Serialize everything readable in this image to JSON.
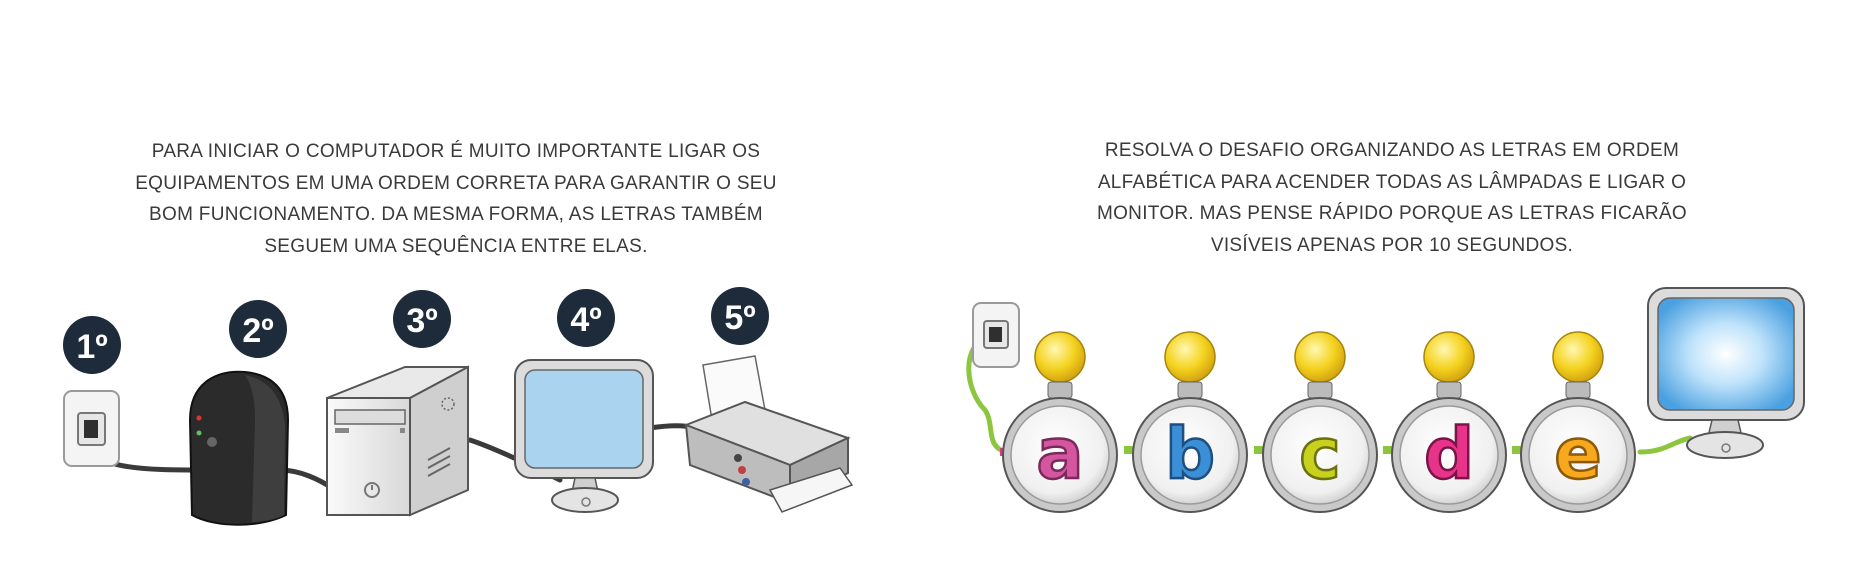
{
  "left_panel": {
    "instruction_lines": [
      "PARA INICIAR O COMPUTADOR É MUITO IMPORTANTE LIGAR OS",
      "EQUIPAMENTOS EM UMA ORDEM CORRETA PARA GARANTIR O SEU",
      "BOM FUNCIONAMENTO. DA MESMA FORMA, AS LETRAS TAMBÉM",
      "SEGUEM UMA SEQUÊNCIA ENTRE ELAS."
    ],
    "steps": [
      {
        "badge": "1º",
        "device": "wall-outlet"
      },
      {
        "badge": "2º",
        "device": "voltage-stabilizer"
      },
      {
        "badge": "3º",
        "device": "cpu-tower"
      },
      {
        "badge": "4º",
        "device": "monitor"
      },
      {
        "badge": "5º",
        "device": "printer"
      }
    ]
  },
  "right_panel": {
    "instruction_lines": [
      "RESOLVA O DESAFIO ORGANIZANDO AS LETRAS EM ORDEM",
      "ALFABÉTICA PARA ACENDER TODAS AS LÂMPADAS E LIGAR O",
      "MONITOR. MAS PENSE RÁPIDO PORQUE AS LETRAS FICARÃO",
      "VISÍVEIS APENAS POR 10 SEGUNDOS."
    ],
    "letters": [
      {
        "char": "a",
        "color": "#d3569e"
      },
      {
        "char": "b",
        "color": "#3b8fd6"
      },
      {
        "char": "c",
        "color": "#c8d21e"
      },
      {
        "char": "d",
        "color": "#e8338a"
      },
      {
        "char": "e",
        "color": "#f7a81c"
      }
    ]
  },
  "colors": {
    "badge": "#1e2b3a",
    "cable_dark": "#3a3a3a",
    "cable_green": "#8cc63f",
    "bulb": "#f4d21e",
    "screen": "#a9d3ee"
  }
}
